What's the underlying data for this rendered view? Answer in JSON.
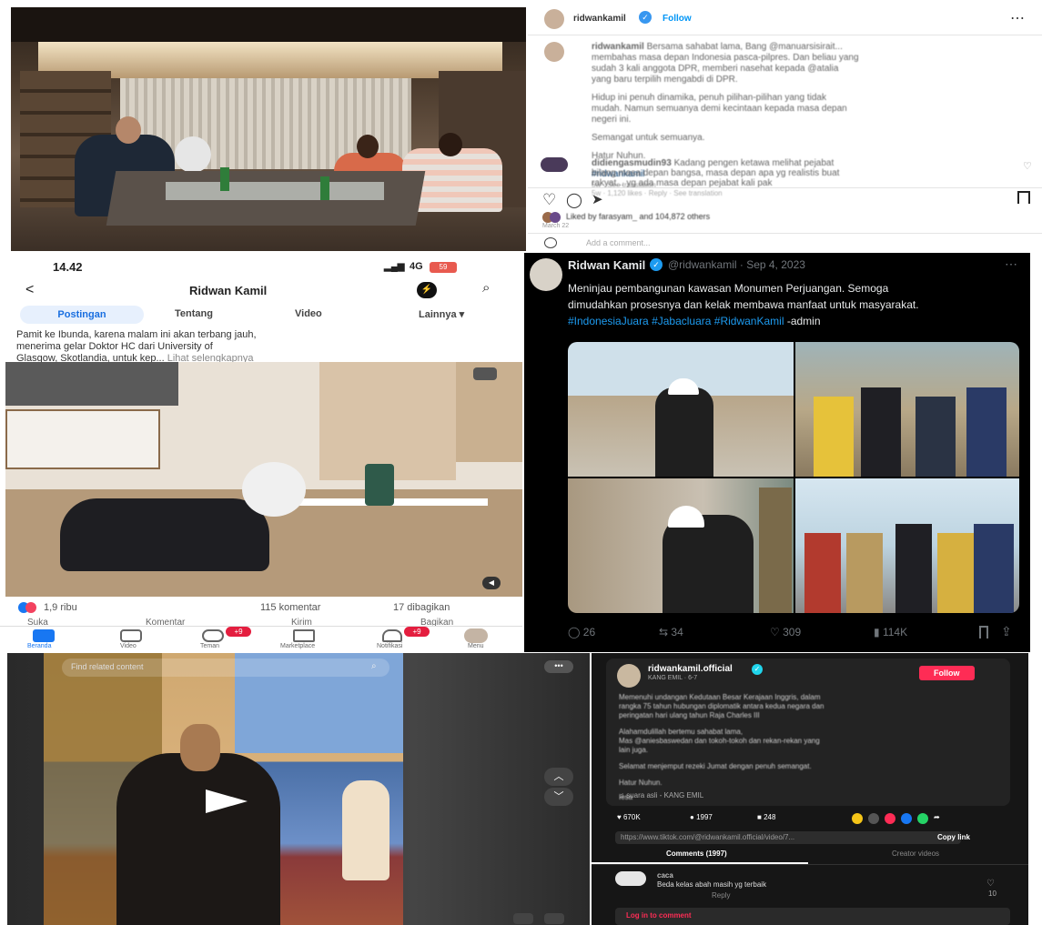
{
  "instagram": {
    "username": "ridwankamil",
    "follow_label": "Follow",
    "more_glyph": "⋯",
    "caption_user": "ridwankamil",
    "caption_lines": [
      "Bersama sahabat lama, Bang @manuarsisirait...",
      "membahas masa depan Indonesia pasca-pilpres. Dan beliau yang",
      "sudah 3 kali anggota DPR, memberi nasehat kepada @atalia",
      "yang baru terpilih mengabdi di DPR."
    ],
    "para2": [
      "Hidup ini penuh dinamika, penuh pilihan-pilihan yang tidak",
      "mudah. Namun semuanya demi kecintaan kepada masa depan",
      "negeri ini."
    ],
    "para3": "Semangat untuk semuanya.",
    "para4": "Hatur Nuhun.",
    "hashtag": "#ridwankamil",
    "meta": "5w · See translation",
    "comment_user": "didiengasmudin93",
    "comment_text_1": "Kadang pengen ketawa melihat pejabat",
    "comment_text_2": "bilang masa depan bangsa, masa depan apa yg realistis buat",
    "comment_text_3": "rakyat... yg ada masa depan pejabat kali pak",
    "comment_meta": "5w · 1,120 likes · Reply · See translation",
    "liked_by": "Liked by farasyam_ and 104,872 others",
    "date": "March 22",
    "add_comment_placeholder": "Add a comment..."
  },
  "facebook": {
    "time": "14.42",
    "signal": "4G",
    "battery": "59",
    "page_title": "Ridwan Kamil",
    "tabs": [
      "Postingan",
      "Tentang",
      "Video",
      "Lainnya ▾"
    ],
    "post_text_1": "Pamit ke Ibunda, karena malam ini akan terbang jauh,",
    "post_text_2": "menerima gelar Doktor HC dari University of",
    "post_text_3": "Glasgow, Skotlandia, untuk kep...",
    "see_more": "Lihat selengkapnya",
    "reactions_count": "1,9 ribu",
    "comments_count": "115 komentar",
    "shares_count": "17 dibagikan",
    "actions": [
      "Suka",
      "Komentar",
      "Kirim",
      "Bagikan"
    ],
    "bottom_nav": [
      {
        "label": "Beranda",
        "badge": ""
      },
      {
        "label": "Video",
        "badge": ""
      },
      {
        "label": "Teman",
        "badge": "9"
      },
      {
        "label": "Marketplace",
        "badge": ""
      },
      {
        "label": "Notifikasi",
        "badge": "9"
      },
      {
        "label": "Menu",
        "badge": ""
      }
    ]
  },
  "twitter": {
    "name": "Ridwan Kamil",
    "handle": "@ridwankamil · Sep 4, 2023",
    "more_glyph": "⋯",
    "text_1": "Meninjau pembangunan kawasan Monumen Perjuangan. Semoga",
    "text_2": "dimudahkan prosesnya dan kelak membawa manfaat untuk masyarakat.",
    "hashtags": "#IndonesiaJuara #Jabacluara #RidwanKamil",
    "suffix": "-admin",
    "replies": "26",
    "retweets": "34",
    "likes": "309",
    "views": "114K",
    "accent": "#1d9bf0"
  },
  "tiktok": {
    "search_placeholder": "Find related content",
    "username": "ridwankamil.official",
    "subtitle": "KANG EMIL · 6-7",
    "follow_label": "Follow",
    "caption_1": "Memenuhi undangan Kedutaan Besar Kerajaan Inggris, dalam",
    "caption_2": "rangka 75 tahun hubungan diplomatik antara kedua negara dan",
    "caption_3": "peringatan hari ulang tahun Raja Charles III",
    "caption_4": "Alahamdulillah bertemu sahabat lama,",
    "caption_5": "Mas @aniesbaswedan dan tokoh-tokoh dan rekan-rekan yang",
    "caption_6": "lain juga.",
    "caption_7": "Selamat menjemput rezeki Jumat dengan penuh semangat.",
    "caption_8": "Hatur Nuhun.",
    "caption_9": "Iesa",
    "sound": "suara asli - KANG EMIL",
    "likes": "670K",
    "comments": "1997",
    "saves": "248",
    "link": "https://www.tiktok.com/@ridwankamil.official/video/7...",
    "copy_link": "Copy link",
    "tab_comments": "Comments (1997)",
    "tab_creator": "Creator videos",
    "commenter": "caca",
    "comment_text": "Beda kelas abah masih yg terbaik",
    "comment_reply": "Reply",
    "comment_likes": "10",
    "login_prompt": "Log in to comment"
  }
}
